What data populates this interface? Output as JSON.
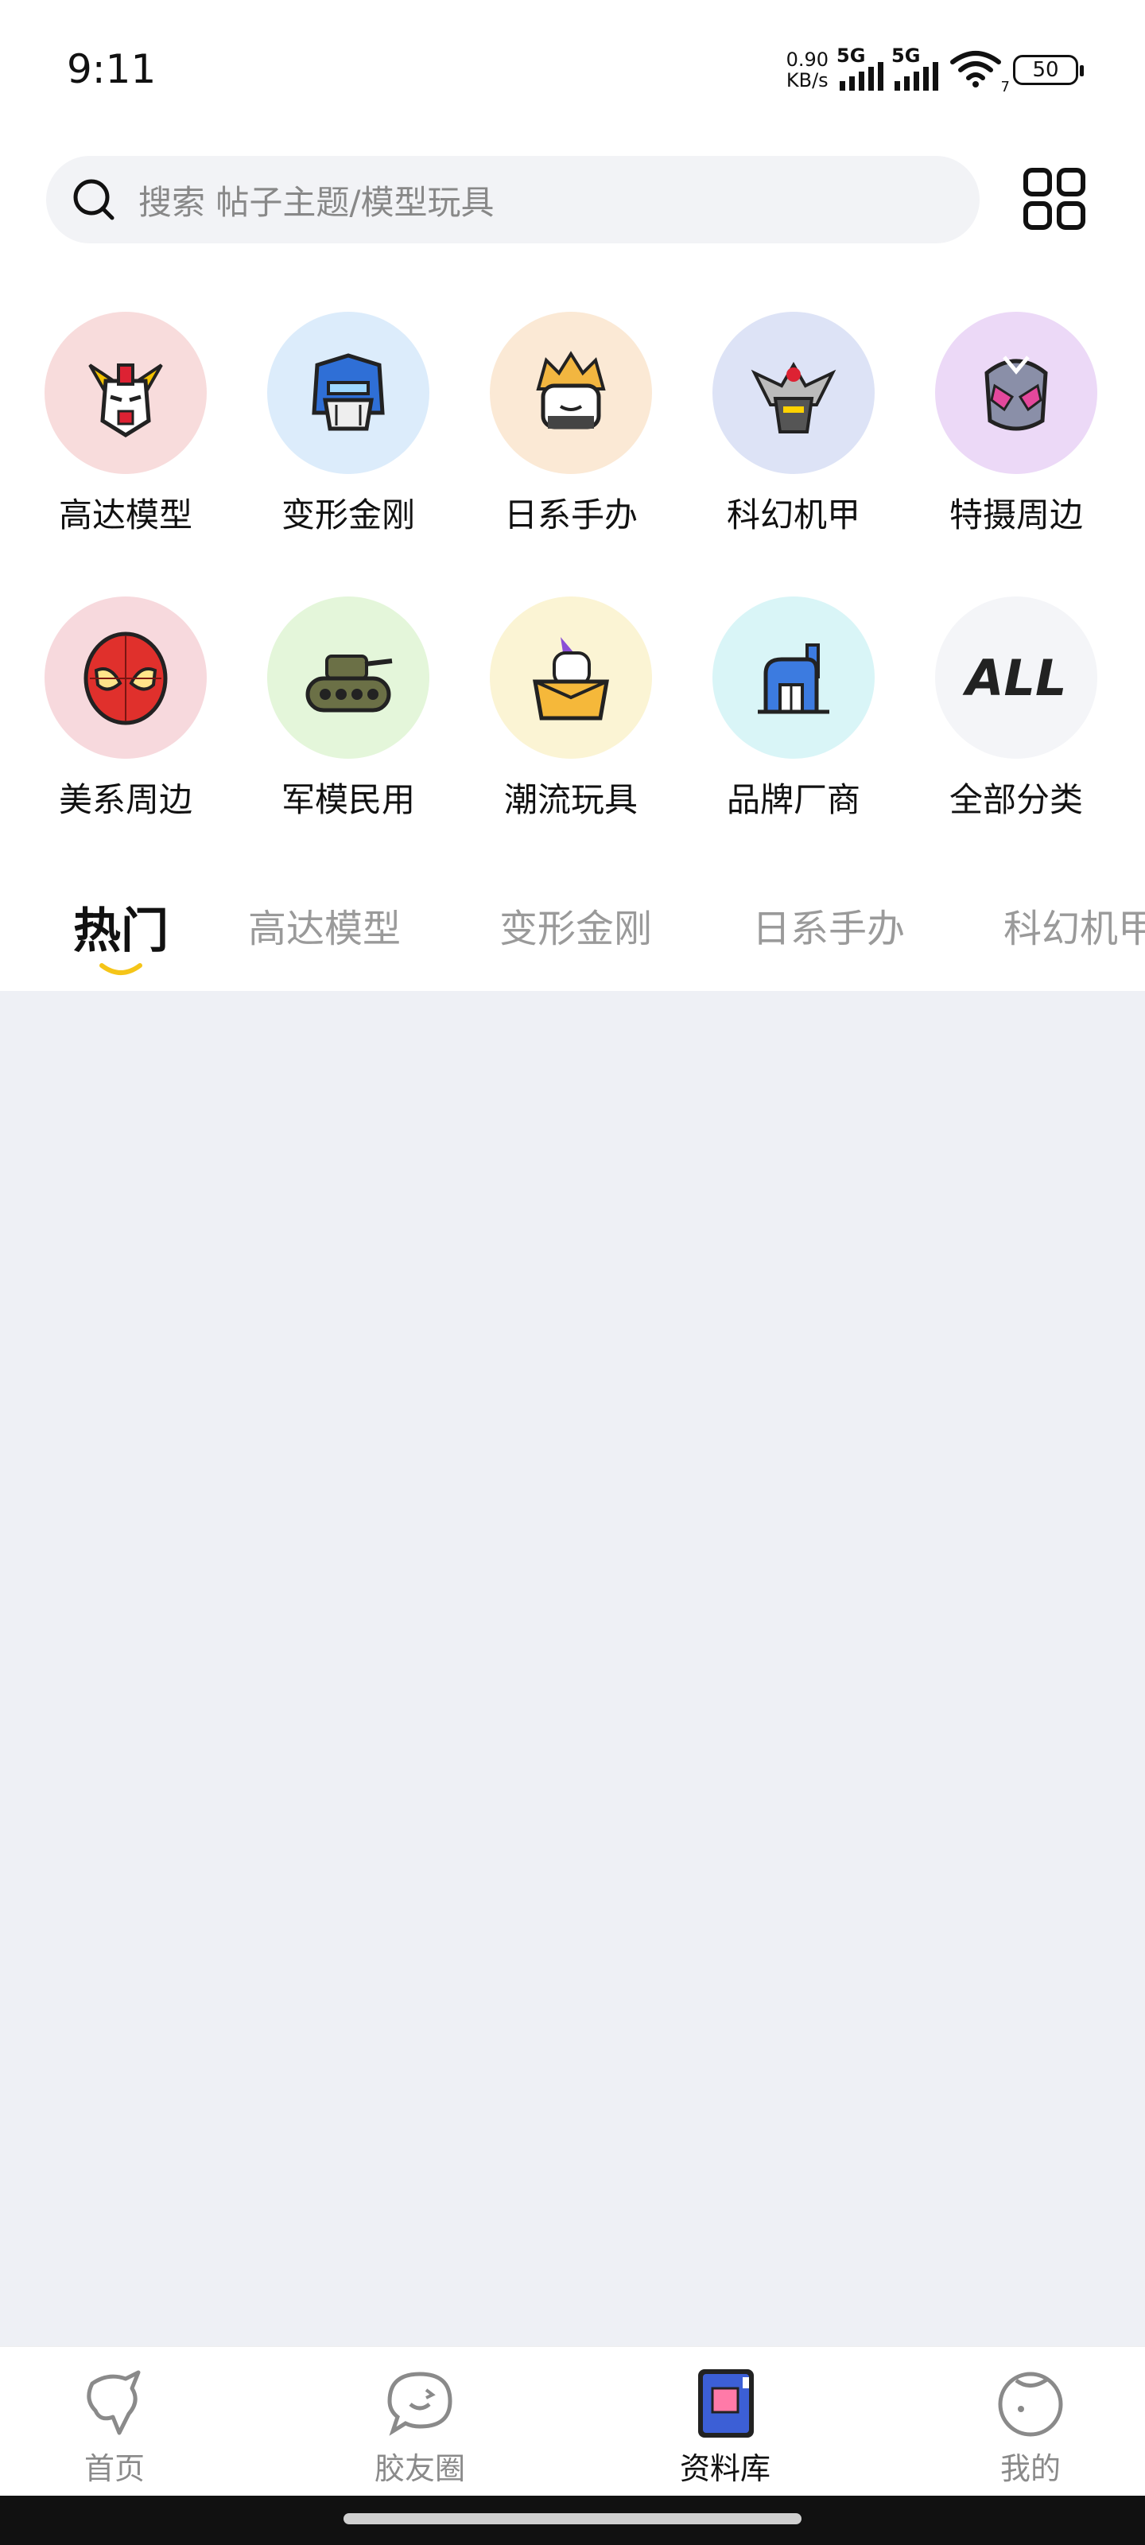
{
  "status": {
    "time": "9:11",
    "net_speed_value": "0.90",
    "net_speed_unit": "KB/s",
    "signal1_tag": "5G",
    "signal2_tag": "5G",
    "wifi_sub": "7",
    "battery": "50"
  },
  "search": {
    "placeholder": "搜索 帖子主题/模型玩具"
  },
  "categories": [
    {
      "label": "高达模型",
      "icon": "gundam-icon",
      "bg": "#f8dcdc"
    },
    {
      "label": "变形金刚",
      "icon": "optimus-icon",
      "bg": "#dcecfb"
    },
    {
      "label": "日系手办",
      "icon": "anime-figure-icon",
      "bg": "#fbe9d5"
    },
    {
      "label": "科幻机甲",
      "icon": "mecha-icon",
      "bg": "#dde3f6"
    },
    {
      "label": "特摄周边",
      "icon": "kamen-rider-icon",
      "bg": "#ecd9f7"
    },
    {
      "label": "美系周边",
      "icon": "spiderman-icon",
      "bg": "#f7d9dd"
    },
    {
      "label": "军模民用",
      "icon": "tank-icon",
      "bg": "#e4f6da"
    },
    {
      "label": "潮流玩具",
      "icon": "unicorn-box-icon",
      "bg": "#fbf4d4"
    },
    {
      "label": "品牌厂商",
      "icon": "factory-icon",
      "bg": "#d9f5f7"
    },
    {
      "label": "全部分类",
      "icon": "all-icon",
      "bg": "#f4f5f8",
      "badge": "ALL"
    }
  ],
  "tabs": [
    "热门",
    "高达模型",
    "变形金刚",
    "日系手办",
    "科幻机甲"
  ],
  "nav": [
    {
      "label": "首页",
      "icon": "home-unicorn-icon"
    },
    {
      "label": "胶友圈",
      "icon": "chat-bubble-icon"
    },
    {
      "label": "资料库",
      "icon": "library-book-icon"
    },
    {
      "label": "我的",
      "icon": "profile-face-icon"
    }
  ],
  "colors": {
    "accent_yellow": "#f5c518",
    "content_bg": "#eef0f5"
  }
}
